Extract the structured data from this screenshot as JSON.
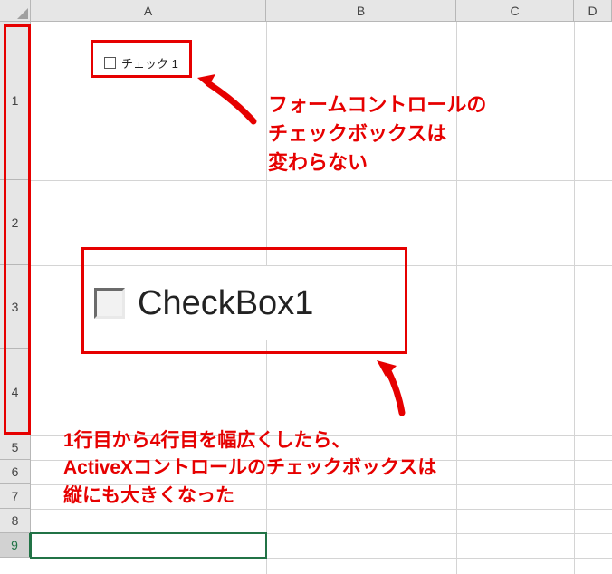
{
  "columns": [
    "A",
    "B",
    "C",
    "D"
  ],
  "rows": [
    "1",
    "2",
    "3",
    "4",
    "5",
    "6",
    "7",
    "8",
    "9"
  ],
  "form_checkbox": {
    "label": "チェック 1",
    "checked": false
  },
  "activex_checkbox": {
    "label": "CheckBox1",
    "checked": false
  },
  "annotation_top": {
    "line1": "フォームコントロールの",
    "line2": "チェックボックスは",
    "line3": "変わらない"
  },
  "annotation_bottom": {
    "line1": "1行目から4行目を幅広くしたら、",
    "line2": "ActiveXコントロールのチェックボックスは",
    "line3": "縦にも大きくなった"
  },
  "selected_cell": "A9"
}
